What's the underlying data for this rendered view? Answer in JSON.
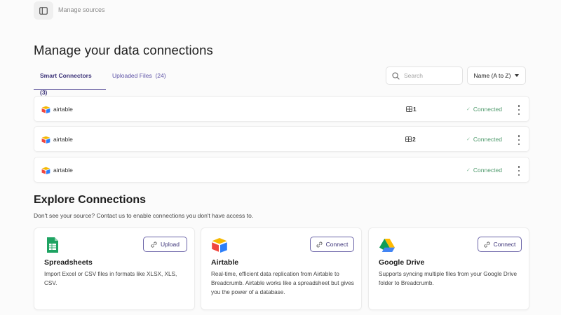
{
  "header": {
    "breadcrumb": "Manage sources",
    "toggle_icon": "sidebar-toggle-icon"
  },
  "page": {
    "title": "Manage your data connections"
  },
  "tabs": [
    {
      "label": "Smart Connectors",
      "count": "(3)",
      "active": true
    },
    {
      "label": "Uploaded Files",
      "count": "(24)",
      "active": false
    }
  ],
  "search": {
    "placeholder": "Search",
    "value": ""
  },
  "sort": {
    "label": "Name (A to Z)"
  },
  "connections": [
    {
      "name": "airtable",
      "count": "1",
      "status": "Connected"
    },
    {
      "name": "airtable",
      "count": "2",
      "status": "Connected"
    },
    {
      "name": "airtable",
      "count": "",
      "status": "Connected"
    }
  ],
  "explore": {
    "title": "Explore Connections",
    "subtitle": "Don't see your source? Contact us to enable connections you don't have access to.",
    "cards": [
      {
        "icon": "spreadsheet-icon",
        "title": "Spreadsheets",
        "button": "Upload",
        "description": "Import Excel or CSV files in formats like XLSX, XLS, CSV."
      },
      {
        "icon": "airtable-icon",
        "title": "Airtable",
        "button": "Connect",
        "description": "Real-time, efficient data replication from Airtable to Breadcrumb. Airtable works like a spreadsheet but gives you the power of a database."
      },
      {
        "icon": "google-drive-icon",
        "title": "Google Drive",
        "button": "Connect",
        "description": "Supports syncing multiple files from your Google Drive folder to Breadcrumb."
      }
    ]
  },
  "colors": {
    "accent": "#4a3f8f",
    "connected": "#4f9a6c",
    "background": "#fbfbfb"
  }
}
